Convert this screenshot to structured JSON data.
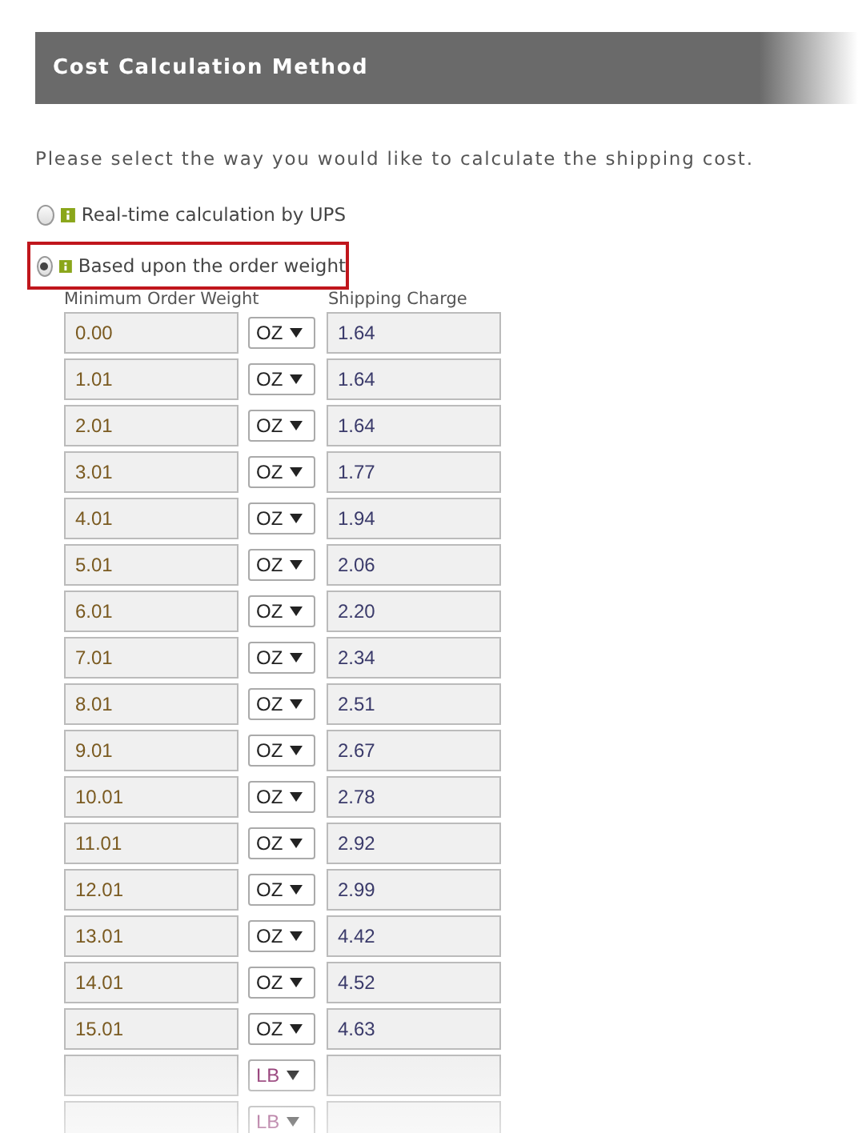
{
  "section": {
    "title": "Cost Calculation Method"
  },
  "instruction": "Please select the way you would like to calculate the shipping cost.",
  "options": [
    {
      "label": "Real-time calculation by UPS",
      "selected": false,
      "highlighted": false
    },
    {
      "label": "Based upon the order weight",
      "selected": true,
      "highlighted": true
    }
  ],
  "table": {
    "columns": [
      "Minimum Order Weight",
      "Shipping Charge"
    ],
    "rows": [
      {
        "weight": "0.00",
        "unit": "OZ",
        "charge": "1.64"
      },
      {
        "weight": "1.01",
        "unit": "OZ",
        "charge": "1.64"
      },
      {
        "weight": "2.01",
        "unit": "OZ",
        "charge": "1.64"
      },
      {
        "weight": "3.01",
        "unit": "OZ",
        "charge": "1.77"
      },
      {
        "weight": "4.01",
        "unit": "OZ",
        "charge": "1.94"
      },
      {
        "weight": "5.01",
        "unit": "OZ",
        "charge": "2.06"
      },
      {
        "weight": "6.01",
        "unit": "OZ",
        "charge": "2.20"
      },
      {
        "weight": "7.01",
        "unit": "OZ",
        "charge": "2.34"
      },
      {
        "weight": "8.01",
        "unit": "OZ",
        "charge": "2.51"
      },
      {
        "weight": "9.01",
        "unit": "OZ",
        "charge": "2.67"
      },
      {
        "weight": "10.01",
        "unit": "OZ",
        "charge": "2.78"
      },
      {
        "weight": "11.01",
        "unit": "OZ",
        "charge": "2.92"
      },
      {
        "weight": "12.01",
        "unit": "OZ",
        "charge": "2.99"
      },
      {
        "weight": "13.01",
        "unit": "OZ",
        "charge": "4.42"
      },
      {
        "weight": "14.01",
        "unit": "OZ",
        "charge": "4.52"
      },
      {
        "weight": "15.01",
        "unit": "OZ",
        "charge": "4.63"
      },
      {
        "unit": "LB"
      },
      {
        "unit": "LB"
      }
    ]
  }
}
